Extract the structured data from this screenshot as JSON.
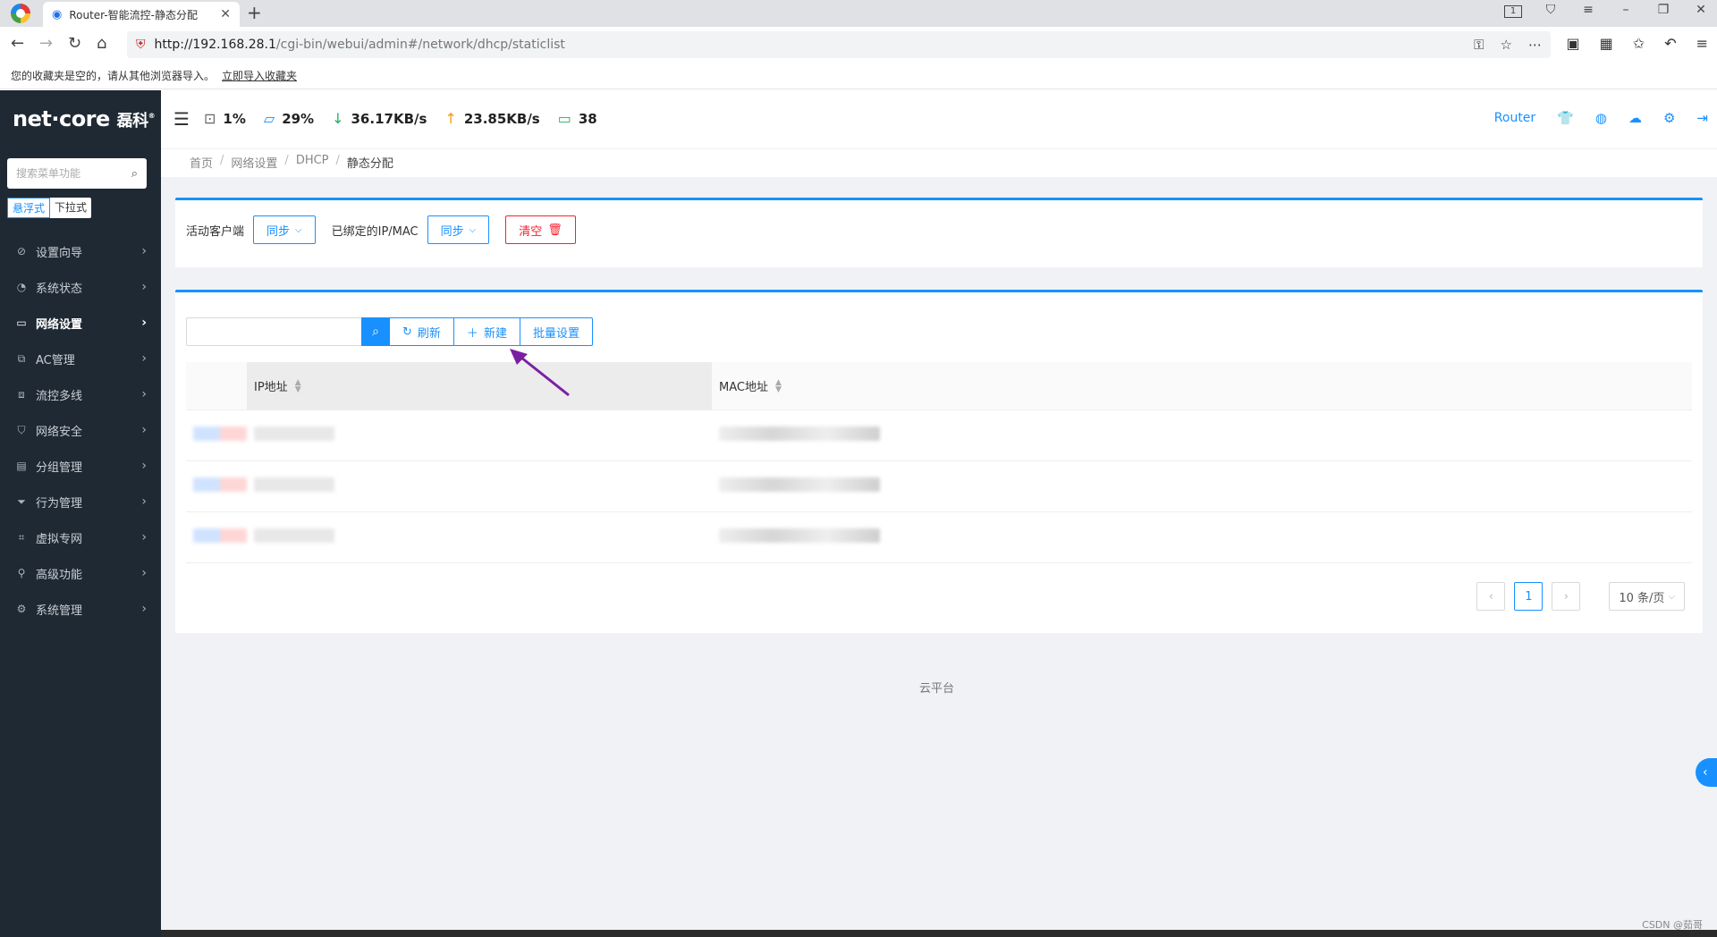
{
  "browser": {
    "tab_title": "Router-智能流控-静态分配",
    "url_host": "http://192.168.28.1",
    "url_path": "/cgi-bin/webui/admin#/network/dhcp/staticlist",
    "bookmark_notice": "您的收藏夹是空的，请从其他浏览器导入。",
    "bookmark_import": "立即导入收藏夹"
  },
  "brand": {
    "logo_text_1": "net",
    "logo_dot": "·",
    "logo_text_2": "core",
    "logo_cn": "磊科"
  },
  "sidebar": {
    "search_placeholder": "搜索菜单功能",
    "mode_float": "悬浮式",
    "mode_dropdown": "下拉式",
    "items": [
      {
        "label": "设置向导",
        "icon": "compass-icon"
      },
      {
        "label": "系统状态",
        "icon": "dashboard-icon"
      },
      {
        "label": "网络设置",
        "icon": "monitor-icon",
        "active": true
      },
      {
        "label": "AC管理",
        "icon": "network-icon"
      },
      {
        "label": "流控多线",
        "icon": "flow-icon"
      },
      {
        "label": "网络安全",
        "icon": "shield-icon"
      },
      {
        "label": "分组管理",
        "icon": "group-icon"
      },
      {
        "label": "行为管理",
        "icon": "filter-icon"
      },
      {
        "label": "虚拟专网",
        "icon": "vpn-icon"
      },
      {
        "label": "高级功能",
        "icon": "pin-icon"
      },
      {
        "label": "系统管理",
        "icon": "gear-icon"
      }
    ]
  },
  "header": {
    "cpu": "1%",
    "memory": "29%",
    "download": "36.17KB/s",
    "upload": "23.85KB/s",
    "devices": "38",
    "router_label": "Router"
  },
  "breadcrumb": [
    "首页",
    "网络设置",
    "DHCP",
    "静态分配"
  ],
  "panel1": {
    "active_clients_label": "活动客户端",
    "sync_label_1": "同步",
    "bound_label": "已绑定的IP/MAC",
    "sync_label_2": "同步",
    "clear_label": "清空"
  },
  "toolbar": {
    "search_value": "",
    "refresh_label": "刷新",
    "new_label": "新建",
    "batch_label": "批量设置"
  },
  "table": {
    "columns": [
      "IP地址",
      "MAC地址"
    ]
  },
  "pagination": {
    "current_page": "1",
    "page_size": "10 条/页"
  },
  "footer": {
    "cloud_label": "云平台",
    "watermark": "CSDN @茹哥"
  },
  "colors": {
    "primary": "#1890ff",
    "danger": "#f5222d",
    "sidebar_bg": "#1f2933",
    "annotation_arrow": "#7b1fa2"
  }
}
